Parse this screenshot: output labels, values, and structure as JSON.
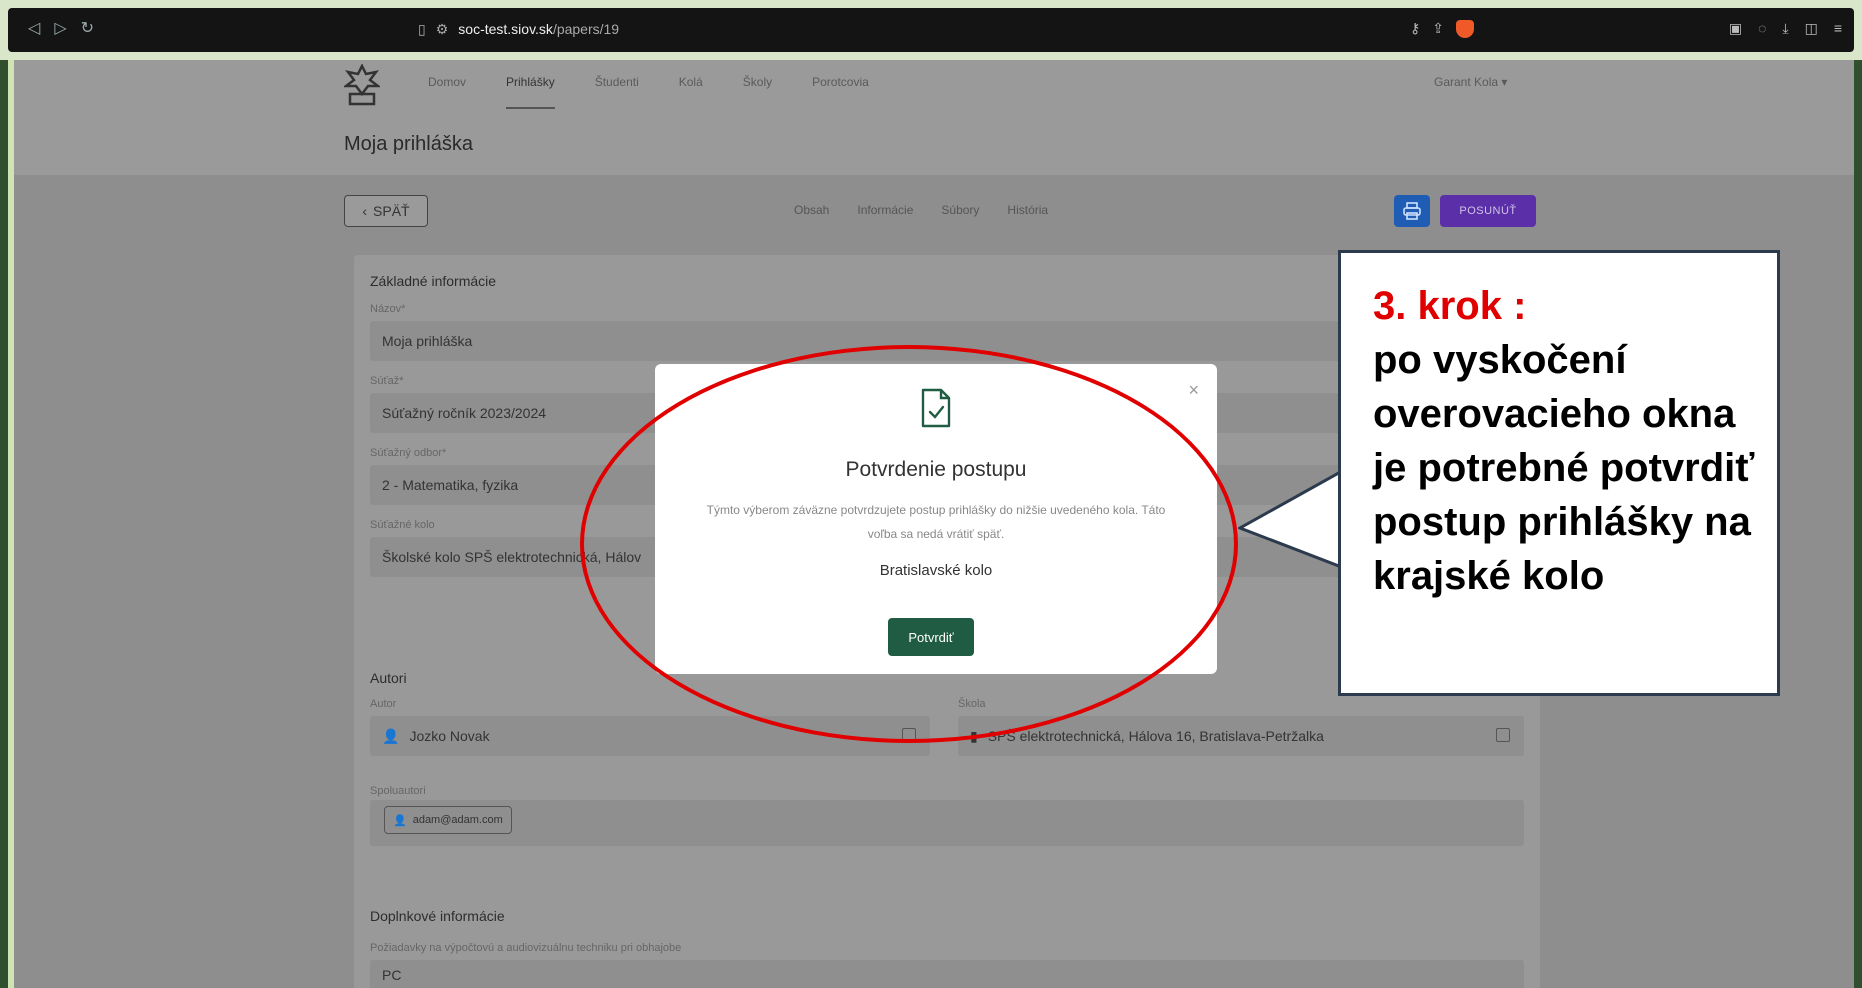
{
  "browser": {
    "url_host": "soc-test.siov.sk",
    "url_path": "/papers/19"
  },
  "nav": {
    "items": [
      "Domov",
      "Prihlášky",
      "Študenti",
      "Kolá",
      "Školy",
      "Porotcovia"
    ],
    "active": "Prihlášky",
    "user": "Garant Kola ▾"
  },
  "page": {
    "title": "Moja prihláška",
    "back_label": "SPÄŤ",
    "tabs": [
      "Obsah",
      "Informácie",
      "Súbory",
      "História"
    ],
    "move_label": "POSUNÚŤ"
  },
  "basic": {
    "section": "Základné informácie",
    "name_label": "Názov*",
    "name_value": "Moja prihláška",
    "competition_label": "Súťaž*",
    "competition_value": "Súťažný ročník 2023/2024",
    "field_label": "Súťažný odbor*",
    "field_value": "2 - Matematika, fyzika",
    "round_label": "Súťažné kolo",
    "round_value": "Školské kolo SPŠ elektrotechnická, Hálov"
  },
  "authors": {
    "section": "Autori",
    "author_label": "Autor",
    "author_value": "Jozko Novak",
    "school_label": "Škola",
    "school_value": "SPŠ elektrotechnická, Hálova 16, Bratislava-Petržalka",
    "coauthors_label": "Spoluautori",
    "coauthor_chip": "adam@adam.com"
  },
  "extra": {
    "section": "Doplnkové informácie",
    "tech_label": "Požiadavky na výpočtovú a audiovizuálnu techniku pri obhajobe",
    "tech_value": "PC"
  },
  "modal": {
    "close": "×",
    "title": "Potvrdenie postupu",
    "description": "Týmto výberom záväzne potvrdzujete postup prihlášky do nižšie uvedeného kola. Táto voľba sa nedá vrátiť späť.",
    "round": "Bratislavské kolo",
    "confirm": "Potvrdiť"
  },
  "callout": {
    "step": "3. krok :",
    "text": "po vyskočení overovacieho okna je potrebné potvrdiť postup prihlášky na krajské kolo"
  },
  "colors": {
    "annotation_red": "#e00000",
    "confirm_green": "#1f5c43",
    "move_purple": "#5b2fa8",
    "print_blue": "#1f5db5"
  }
}
